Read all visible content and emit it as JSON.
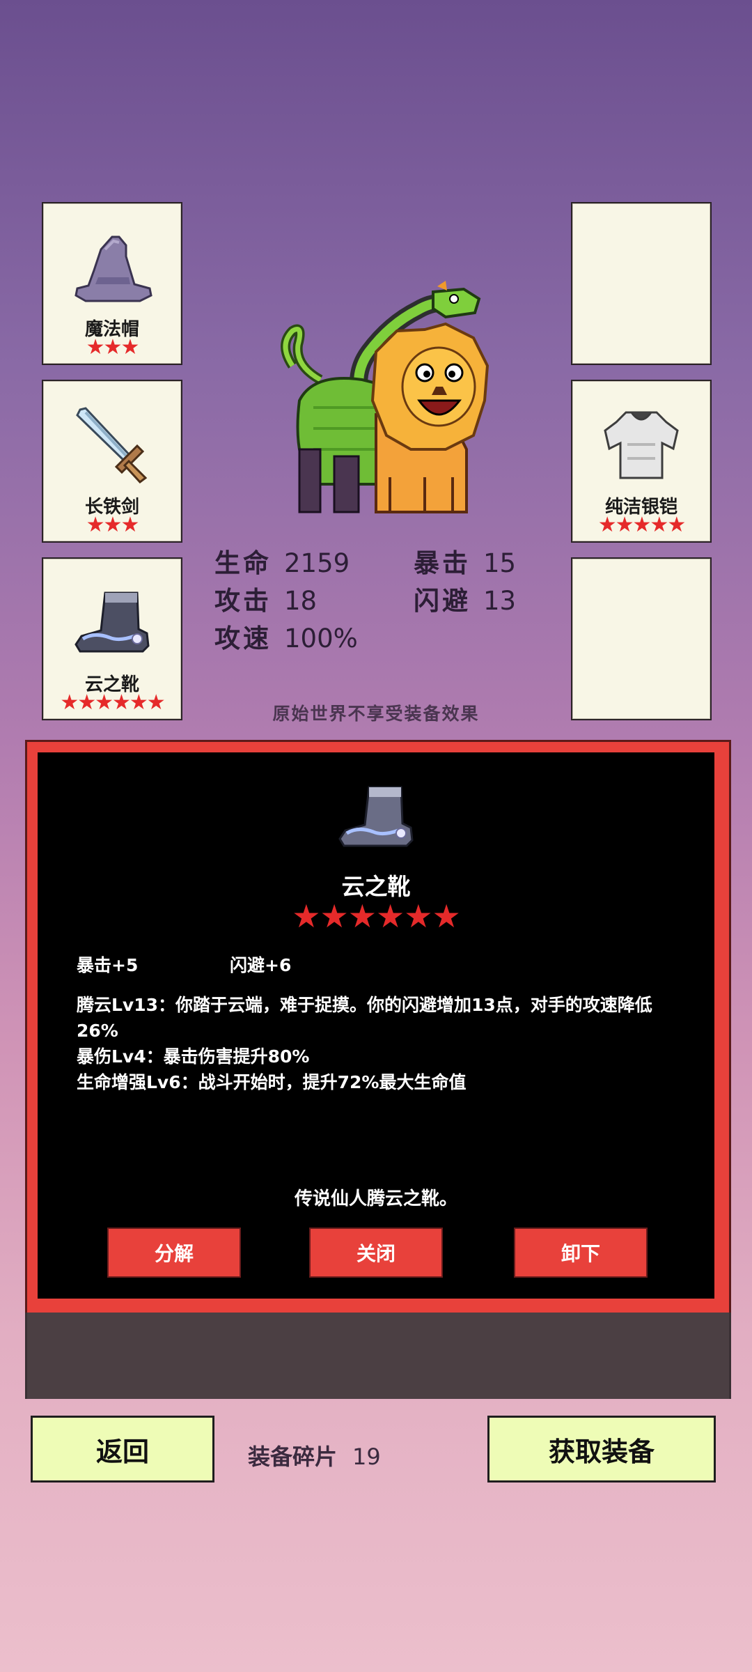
{
  "slots": {
    "hat": {
      "name": "魔法帽",
      "stars": "★★★"
    },
    "sword": {
      "name": "长铁剑",
      "stars": "★★★"
    },
    "boots": {
      "name": "云之靴",
      "stars": "★★★★★★"
    },
    "armor": {
      "name": "纯洁银铠",
      "stars": "★★★★★"
    }
  },
  "stats": {
    "hp": {
      "label": "生命",
      "value": "2159"
    },
    "crit": {
      "label": "暴击",
      "value": "15"
    },
    "atk": {
      "label": "攻击",
      "value": "18"
    },
    "dodge": {
      "label": "闪避",
      "value": "13"
    },
    "speed": {
      "label": "攻速",
      "value": "100%"
    }
  },
  "note": "原始世界不享受装备效果",
  "detail": {
    "title": "云之靴",
    "stars": "★★★★★★",
    "attr1": "暴击+5",
    "attr2": "闪避+6",
    "lines": [
      "腾云Lv13：你踏于云端，难于捉摸。你的闪避增加13点，对手的攻速降低26%",
      "暴伤Lv4：暴击伤害提升80%",
      "生命增强Lv6：战斗开始时，提升72%最大生命值"
    ],
    "flavor": "传说仙人腾云之靴。",
    "buttons": {
      "decompose": "分解",
      "close": "关闭",
      "unequip": "卸下"
    }
  },
  "bottom": {
    "back": "返回",
    "fragments_label": "装备碎片",
    "fragments_value": "19",
    "get_equipment": "获取装备"
  },
  "colors": {
    "accent_red": "#e8413b",
    "star_red": "#e52a2a",
    "button_green": "#eefcb6"
  }
}
